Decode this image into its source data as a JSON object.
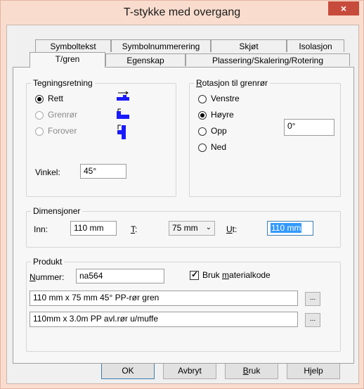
{
  "window": {
    "title": "T-stykke med overgang",
    "close_label": "×"
  },
  "tabs_row1": [
    "Symboltekst",
    "Symbolnummerering",
    "Skjøt",
    "Isolasjon"
  ],
  "tabs_row2": [
    "T/gren",
    "Egenskap",
    "Plassering/Skalering/Rotering"
  ],
  "tegning": {
    "legend": "Tegningsretning",
    "options": [
      "Rett",
      "Grenrør",
      "Forover"
    ],
    "vinkel_label": "Vinkel:",
    "vinkel_value": "45°"
  },
  "rotasjon": {
    "legend_first": "R",
    "legend_rest": "otasjon til grenrør",
    "options": [
      "Venstre",
      "Høyre",
      "Opp",
      "Ned"
    ],
    "angle_value": "0°"
  },
  "dimensjoner": {
    "legend": "Dimensjoner",
    "inn_label": "Inn:",
    "inn_value": "110 mm",
    "t_label_first": "T",
    "t_label_rest": ":",
    "t_value": "75 mm",
    "ut_label_first": "U",
    "ut_label_rest": "t:",
    "ut_value": "110 mm"
  },
  "produkt": {
    "legend": "Produkt",
    "nummer_label_first": "N",
    "nummer_label_rest": "ummer:",
    "nummer_value": "na564",
    "bruk_label_pre": "Bruk ",
    "bruk_label_u": "m",
    "bruk_label_post": "aterialkode",
    "line1": "110 mm x 75 mm 45° PP-rør gren",
    "line2": "110mm x 3.0m PP avl.rør u/muffe",
    "browse_label": "..."
  },
  "buttons": {
    "ok": "OK",
    "avbryt": "Avbryt",
    "bruk_first": "B",
    "bruk_rest": "ruk",
    "hjelp": "Hjelp"
  },
  "colors": {
    "accent_blue": "#1a1aff",
    "close_red": "#c74b3c",
    "selection": "#3399ff"
  }
}
